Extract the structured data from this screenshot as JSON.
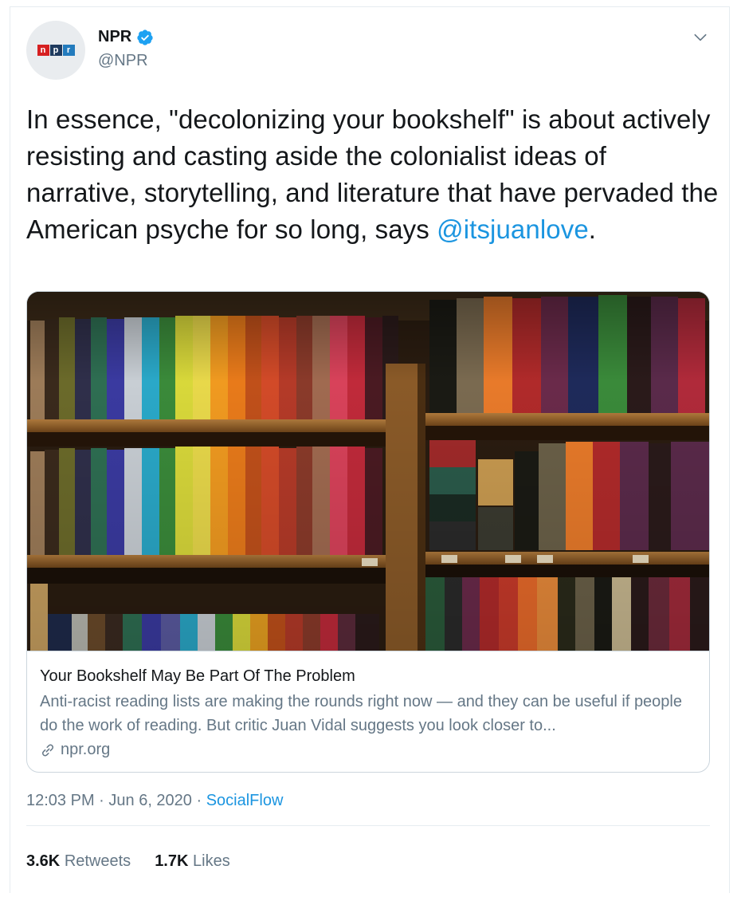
{
  "author": {
    "display_name": "NPR",
    "handle": "@NPR",
    "verified": true,
    "avatar_letters": [
      "n",
      "p",
      "r"
    ]
  },
  "tweet": {
    "text_before_mention": "In essence, \"decolonizing your bookshelf\" is about actively resisting and casting aside the colonialist ideas of narrative, storytelling, and literature that have pervaded the American psyche for so long, says ",
    "mention": "@itsjuanlove",
    "text_after_mention": "."
  },
  "card": {
    "title": "Your Bookshelf May Be Part Of The Problem",
    "description": "Anti-racist reading lists are making the rounds right now — and they can be useful if people do the work of reading. But critic Juan Vidal suggests you look closer to...",
    "domain": "npr.org"
  },
  "meta": {
    "time": "12:03 PM",
    "separator": " · ",
    "date": "Jun 6, 2020",
    "source": "SocialFlow"
  },
  "stats": {
    "retweets_count": "3.6K",
    "retweets_label": "Retweets",
    "likes_count": "1.7K",
    "likes_label": "Likes"
  },
  "colors": {
    "link": "#1b95e0",
    "secondary_text": "#657786",
    "primary_text": "#14171a",
    "border": "#ccd6dd"
  },
  "icons": {
    "verified": "verified-badge-icon",
    "caret": "chevron-down-icon",
    "link": "link-icon"
  }
}
